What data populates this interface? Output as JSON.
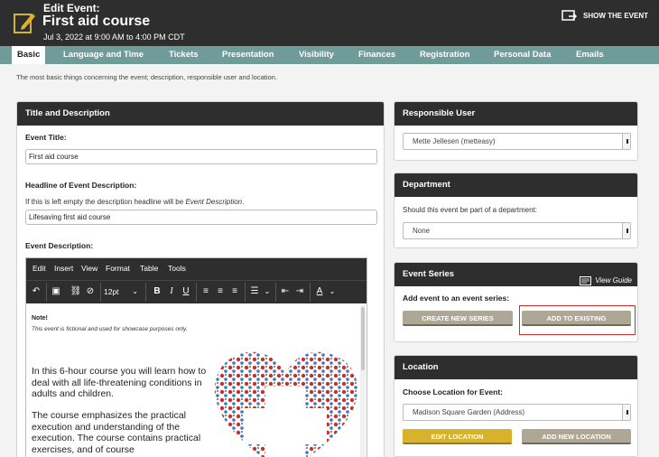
{
  "header": {
    "label": "Edit Event:",
    "title": "First aid course",
    "date": "Jul 3, 2022 at 9:00 AM to 4:00 PM CDT",
    "show_event": "SHOW THE EVENT"
  },
  "tabs": [
    "Basic",
    "Language and Time",
    "Tickets",
    "Presentation",
    "Visibility",
    "Finances",
    "Registration",
    "Personal Data",
    "Emails"
  ],
  "subtitle": "The most basic things concerning the event; description, responsible user and location.",
  "title_desc": {
    "heading": "Title and Description",
    "event_title_label": "Event Title:",
    "event_title_value": "First aid course",
    "headline_label": "Headline of Event Description:",
    "headline_help": "If this is left empty the description headline will be",
    "headline_help_em": "Event Description",
    "headline_help_end": ".",
    "headline_value": "Lifesaving first aid course",
    "desc_label": "Event Description:"
  },
  "editor": {
    "menu": [
      "Edit",
      "Insert",
      "View",
      "Format",
      "Table",
      "Tools"
    ],
    "font_size": "12pt",
    "note_title": "Note!",
    "note_text": "This event is fictional and used for showcase purposes only.",
    "para1": "In this 6-hour course you will learn how to deal with all life-threatening conditions in adults and children.",
    "para2": "The course emphasizes the practical execution and understanding of the execution. The course contains practical exercises, and of course"
  },
  "responsible": {
    "heading": "Responsible User",
    "value": "Mette Jellesen (metteasy)"
  },
  "department": {
    "heading": "Department",
    "question": "Should this event be part of a department:",
    "value": "None"
  },
  "series": {
    "heading": "Event Series",
    "guide": "View Guide",
    "add_label": "Add event to an event series:",
    "create_btn": "CREATE NEW SERIES",
    "existing_btn": "ADD TO EXISTING"
  },
  "location": {
    "heading": "Location",
    "choose_label": "Choose Location for Event:",
    "value": "Madison Square Garden (Address)",
    "edit_btn": "EDIT LOCATION",
    "add_btn": "ADD NEW LOCATION"
  }
}
